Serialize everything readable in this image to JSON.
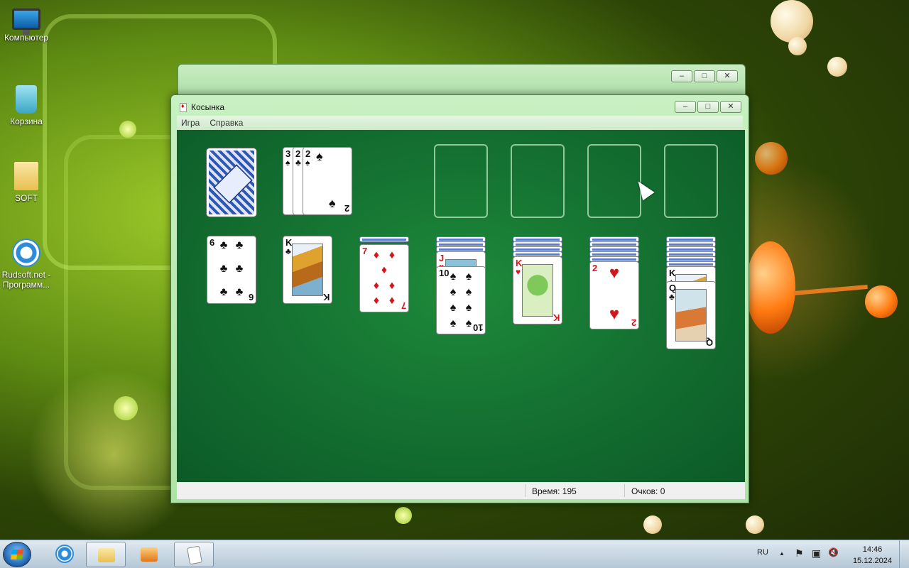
{
  "desktop": {
    "icons": [
      {
        "label": "Компьютер",
        "icon": "computer-icon"
      },
      {
        "label": "Корзина",
        "icon": "recycle-bin-icon"
      },
      {
        "label": "SOFT",
        "icon": "folder-icon"
      },
      {
        "label": "Rudsoft.net -",
        "label2": "Программ...",
        "icon": "internet-explorer-icon"
      }
    ]
  },
  "window": {
    "title": "Косынка",
    "menu": [
      "Игра",
      "Справка"
    ],
    "controls": {
      "minimize": "–",
      "maximize": "□",
      "close": "✕"
    }
  },
  "game": {
    "waste": [
      {
        "rank": "3",
        "suit": "♠"
      },
      {
        "rank": "2",
        "suit": "♣"
      },
      {
        "rank": "2",
        "suit": "♠"
      }
    ],
    "tableau": [
      {
        "rank": "6",
        "suit": "♣"
      },
      {
        "rank": "K",
        "suit": "♣"
      },
      {
        "rank": "7",
        "suit": "♦"
      },
      {
        "rank": "J",
        "suit": "♥"
      },
      {
        "rank": "10",
        "suit": "♠"
      },
      {
        "rank": "K",
        "suit": "♥"
      },
      {
        "rank": "2",
        "suit": "♥"
      },
      {
        "rank": "K",
        "suit": "♠"
      },
      {
        "rank": "Q",
        "suit": "♣"
      }
    ]
  },
  "status": {
    "time_label": "Время:",
    "time_value": "195",
    "score_label": "Очков:",
    "score_value": "0"
  },
  "taskbar": {
    "lang": "RU",
    "time": "14:46",
    "date": "15.12.2024",
    "tray_arrow": "▲",
    "tray_flag": "⚑",
    "tray_network": "▣",
    "tray_volume": "🔇"
  }
}
